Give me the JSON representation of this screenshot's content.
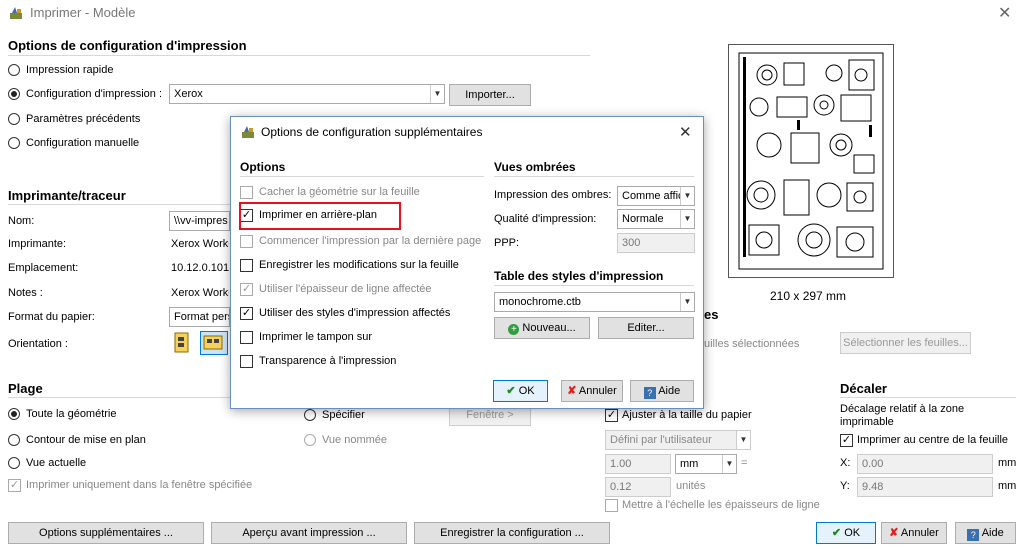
{
  "window": {
    "title": "Imprimer - Modèle",
    "close": "✕"
  },
  "config": {
    "header": "Options de configuration d'impression",
    "opt_rapide": "Impression rapide",
    "opt_config": "Configuration d'impression :",
    "config_value": "Xerox",
    "import_btn": "Importer...",
    "opt_prec": "Paramètres précédents",
    "opt_manual": "Configuration manuelle"
  },
  "printer": {
    "header": "Imprimante/traceur",
    "name_label": "Nom:",
    "name_value": "\\\\vv-impres",
    "printer_label": "Imprimante:",
    "printer_value": "Xerox WorkC",
    "loc_label": "Emplacement:",
    "loc_value": "10.12.0.101_",
    "notes_label": "Notes :",
    "notes_value": "Xerox WorkC",
    "paper_label": "Format du papier:",
    "paper_value": "Format pers",
    "orient_label": "Orientation :"
  },
  "preview": {
    "size": "210 x 297 mm"
  },
  "sheets": {
    "partial_header": "es",
    "sel_label": "uilles sélectionnées",
    "sel_btn": "Sélectionner les feuilles..."
  },
  "range": {
    "header": "Plage",
    "all": "Toute la géométrie",
    "contour": "Contour de mise en plan",
    "current": "Vue actuelle",
    "window_only": "Imprimer uniquement dans la fenêtre spécifiée",
    "specify": "Spécifier",
    "window_btn": "Fenêtre >",
    "named": "Vue nommée"
  },
  "scale": {
    "fit": "Ajuster à la taille du papier",
    "user": "Défini par l'utilisateur",
    "v1": "1.00",
    "unit": "mm",
    "eq": "=",
    "v2": "0.12",
    "units_label": "unités",
    "lineweights": "Mettre à l'échelle les épaisseurs de ligne"
  },
  "offset": {
    "header": "Décaler",
    "desc": "Décalage relatif à la zone imprimable",
    "center": "Imprimer au centre de la feuille",
    "x_label": "X:",
    "x_value": "0.00",
    "x_unit": "mm",
    "y_label": "Y:",
    "y_value": "9.48",
    "y_unit": "mm"
  },
  "bottom": {
    "more": "Options supplémentaires ...",
    "preview": "Aperçu avant impression ...",
    "save": "Enregistrer la configuration ...",
    "ok": "OK",
    "cancel": "Annuler",
    "help": "Aide"
  },
  "dialog": {
    "title": "Options de configuration supplémentaires",
    "close": "✕",
    "options_header": "Options",
    "options": [
      {
        "label": "Cacher la géométrie sur la feuille",
        "checked": false,
        "enabled": false
      },
      {
        "label": "Imprimer en arrière-plan",
        "checked": true,
        "enabled": true
      },
      {
        "label": "Commencer l'impression par la dernière page",
        "checked": false,
        "enabled": false
      },
      {
        "label": "Enregistrer les modifications sur la feuille",
        "checked": false,
        "enabled": true
      },
      {
        "label": "Utiliser l'épaisseur de ligne affectée",
        "checked": true,
        "enabled": false
      },
      {
        "label": "Utiliser des styles d'impression affectés",
        "checked": true,
        "enabled": true
      },
      {
        "label": "Imprimer le tampon sur",
        "checked": false,
        "enabled": true
      },
      {
        "label": "Transparence à l'impression",
        "checked": false,
        "enabled": true
      }
    ],
    "shaded_header": "Vues ombrées",
    "shade_label": "Impression des ombres:",
    "shade_value": "Comme affic",
    "quality_label": "Qualité d'impression:",
    "quality_value": "Normale",
    "ppp_label": "PPP:",
    "ppp_value": "300",
    "style_header": "Table des styles d'impression",
    "style_value": "monochrome.ctb",
    "new_btn": "Nouveau...",
    "edit_btn": "Editer...",
    "ok": "OK",
    "cancel": "Annuler",
    "help": "Aide"
  }
}
